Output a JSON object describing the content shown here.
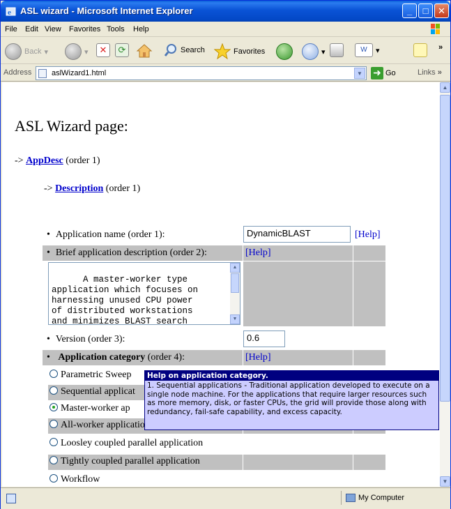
{
  "window": {
    "title": "ASL wizard - Microsoft Internet Explorer"
  },
  "menu": [
    "File",
    "Edit",
    "View",
    "Favorites",
    "Tools",
    "Help"
  ],
  "toolbar": {
    "back": "Back",
    "search": "Search",
    "favorites": "Favorites"
  },
  "address": {
    "label": "Address",
    "value": "aslWizard1.html",
    "go": "Go",
    "links": "Links"
  },
  "page": {
    "heading": "ASL Wizard page:",
    "nav1": {
      "arrow": "->",
      "link": "AppDesc",
      "suffix": "(order 1)"
    },
    "nav2": {
      "arrow": "->",
      "link": "Description",
      "suffix": "(order 1)"
    }
  },
  "form": {
    "app_name_label": "Application name (order 1):",
    "app_name_value": "DynamicBLAST",
    "help": "[Help]",
    "brief_label": "Brief application description (order 2):",
    "description_text": "A master-worker type\napplication which focuses on\nharnessing unused CPU power\nof distributed workstations\nand minimizes BLAST search",
    "version_label": "Version (order 3):",
    "version_value": "0.6",
    "category_label_bold": "Application category",
    "category_label_rest": "(order 4):",
    "options": [
      "Parametric Sweep",
      "Sequential applicat",
      "Master-worker ap",
      "All-worker application",
      "Loosley coupled parallel application",
      "Tightly coupled parallel application",
      "Workflow"
    ]
  },
  "tooltip": {
    "title": "Help on application category.",
    "body": "1. Sequential applications - Traditional application developed to execute on a single node machine. For the applications that require larger resources such as more memory, disk, or faster CPUs, the grid will provide those along with redundancy, fail-safe capability, and excess capacity."
  },
  "status": {
    "zone": "My Computer"
  }
}
